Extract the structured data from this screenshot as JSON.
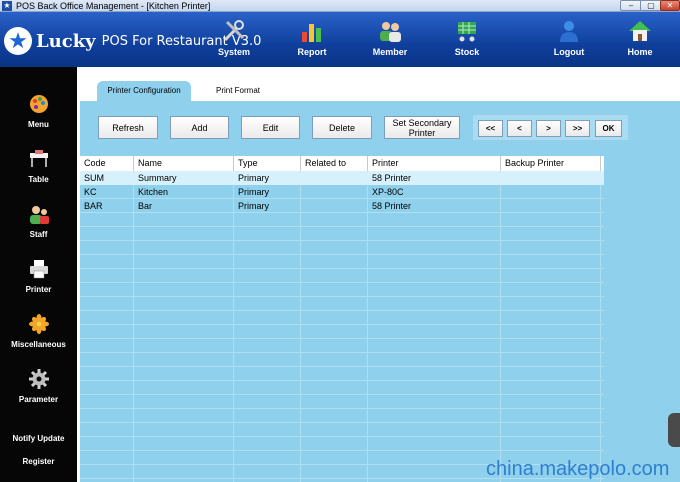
{
  "window": {
    "title": "POS Back Office Management - [Kitchen Printer]",
    "controls": {
      "minimize": "–",
      "maximize": "▢",
      "close": "✕"
    }
  },
  "header": {
    "brand": "Lucky",
    "product": "POS For Restaurant V3.0",
    "nav": [
      {
        "label": "System",
        "icon": "tools-icon"
      },
      {
        "label": "Report",
        "icon": "bar-chart-icon"
      },
      {
        "label": "Member",
        "icon": "members-icon"
      },
      {
        "label": "Stock",
        "icon": "cart-icon"
      },
      {
        "label": "Logout",
        "icon": "user-logout-icon"
      },
      {
        "label": "Home",
        "icon": "home-icon"
      }
    ]
  },
  "sidebar": {
    "items": [
      {
        "label": "Menu",
        "icon": "palette-icon"
      },
      {
        "label": "Table",
        "icon": "table-icon"
      },
      {
        "label": "Staff",
        "icon": "staff-icon"
      },
      {
        "label": "Printer",
        "icon": "printer-icon"
      },
      {
        "label": "Miscellaneous",
        "icon": "flower-icon"
      },
      {
        "label": "Parameter",
        "icon": "gear-icon"
      }
    ],
    "notify_update": "Notify Update",
    "register": "Register"
  },
  "tabs": [
    {
      "label": "Printer Configuration",
      "active": true
    },
    {
      "label": "Print Format",
      "active": false
    }
  ],
  "toolbar": {
    "refresh": "Refresh",
    "add": "Add",
    "edit": "Edit",
    "delete": "Delete",
    "set_secondary": "Set Secondary Printer",
    "first": "<<",
    "prev": "<",
    "next": ">",
    "last": ">>",
    "ok": "OK"
  },
  "table": {
    "columns": [
      "Code",
      "Name",
      "Type",
      "Related to",
      "Printer",
      "Backup Printer"
    ],
    "rows": [
      [
        "SUM",
        "Summary",
        "Primary",
        "",
        "58 Printer",
        ""
      ],
      [
        "KC",
        "Kitchen",
        "Primary",
        "",
        "XP-80C",
        ""
      ],
      [
        "BAR",
        "Bar",
        "Primary",
        "",
        "58 Printer",
        ""
      ]
    ]
  },
  "watermark": "china.makepolo.com",
  "colors": {
    "header_blue": "#0f3f9b",
    "panel_blue": "#8fd1ed",
    "sidebar_black": "#060606",
    "selected_row": "#d6f1fb"
  }
}
